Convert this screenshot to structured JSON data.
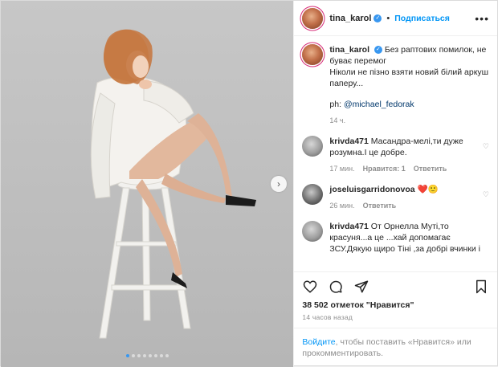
{
  "post": {
    "username": "tina_karol",
    "follow_label": "Подписаться",
    "separator": "•",
    "more_icon": "more-horizontal-icon"
  },
  "caption": {
    "username": "tina_karol",
    "line1": "Без раптових помилок, не буває перемог",
    "line2": "Ніколи не пізно взяти новий білий аркуш паперу...",
    "credit_prefix": "ph:",
    "credit_handle": "@michael_fedorak",
    "time": "14 ч."
  },
  "comments": [
    {
      "username": "krivda471",
      "text": "Масандра-мелі,ти дуже розумна.І це добре.",
      "time": "17 мин.",
      "likes": "Нравится: 1",
      "reply": "Ответить"
    },
    {
      "username": "joseluisgarridonovoa",
      "text": "❤️🙂",
      "time": "26 мин.",
      "reply": "Ответить"
    },
    {
      "username": "krivda471",
      "text": "От Орнелла Муті,то красуня...а це ...хай допомагає ЗСУ.Дякую щиро Тіні ,за добрі вчинки і",
      "time": "",
      "reply": ""
    }
  ],
  "stats": {
    "likes_count": "38 502",
    "likes_label": "отметок \"Нравится\"",
    "posted": "14 часов назад"
  },
  "login": {
    "link": "Войдите",
    "text": ", чтобы поставить «Нравится» или прокомментировать."
  },
  "carousel": {
    "total": 8,
    "active": 0
  },
  "colors": {
    "accent": "#0095f6",
    "link": "#00376b",
    "muted": "#8e8e8e"
  }
}
